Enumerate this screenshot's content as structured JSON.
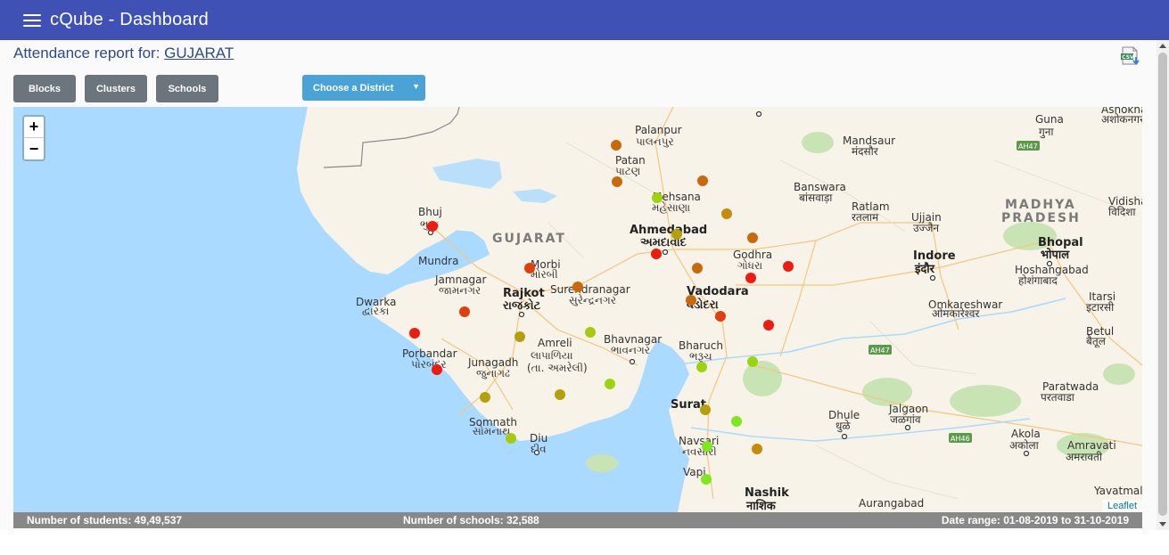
{
  "app": {
    "title": "cQube - Dashboard"
  },
  "report": {
    "prefix": "Attendance report for: ",
    "state": "GUJARAT"
  },
  "buttons": {
    "blocks": "Blocks",
    "clusters": "Clusters",
    "schools": "Schools"
  },
  "district_select": {
    "selected": "Choose a District"
  },
  "map": {
    "zoom_in": "+",
    "zoom_out": "−",
    "attribution": "Leaflet",
    "region_labels": [
      "GUJARAT",
      "MADHYA",
      "PRADESH"
    ],
    "cities": [
      {
        "en": "Bhuj",
        "local": "ભુજ"
      },
      {
        "en": "Mundra",
        "local": ""
      },
      {
        "en": "Jamnagar",
        "local": "જામનગર"
      },
      {
        "en": "Rajkot",
        "local": "રાજકોટ"
      },
      {
        "en": "Morbi",
        "local": "મોરબી"
      },
      {
        "en": "Surendranagar",
        "local": "સુરેન્દ્રનગર"
      },
      {
        "en": "Dwarka",
        "local": "દ્વારકા"
      },
      {
        "en": "Porbandar",
        "local": "પોરબંદર"
      },
      {
        "en": "Junagadh",
        "local": "જુનાગઢ"
      },
      {
        "en": "Amreli",
        "local": "લાપાળિયા"
      },
      {
        "en": "",
        "local": "(તા. અમરેલી)"
      },
      {
        "en": "Bhavnagar",
        "local": "ભાવનગર"
      },
      {
        "en": "Somnath",
        "local": "સોમનાથ"
      },
      {
        "en": "Diu",
        "local": "દીવ"
      },
      {
        "en": "Palanpur",
        "local": "પાલનપુર"
      },
      {
        "en": "Patan",
        "local": "પાટણ"
      },
      {
        "en": "Mehsana",
        "local": "મહેસાણા"
      },
      {
        "en": "Ahmedabad",
        "local": "અમદાવાદ"
      },
      {
        "en": "Godhra",
        "local": "ગોધરા"
      },
      {
        "en": "Vadodara",
        "local": "વડોદરા"
      },
      {
        "en": "Bharuch",
        "local": "ભરૂચ"
      },
      {
        "en": "Surat",
        "local": ""
      },
      {
        "en": "Navsari",
        "local": "નવસારી"
      },
      {
        "en": "Vapi",
        "local": "વાપી"
      },
      {
        "en": "Nashik",
        "local": "नाशिक"
      },
      {
        "en": "Aurangabad",
        "local": ""
      },
      {
        "en": "Dhule",
        "local": "धुळे"
      },
      {
        "en": "Jalgaon",
        "local": "जळगांव"
      },
      {
        "en": "Akola",
        "local": "अकोला"
      },
      {
        "en": "Amravati",
        "local": "अमरावती"
      },
      {
        "en": "Yavatmal",
        "local": ""
      },
      {
        "en": "Paratwada",
        "local": "परतवाडा"
      },
      {
        "en": "Betul",
        "local": "बैतूल"
      },
      {
        "en": "Itarsi",
        "local": "इटारसी"
      },
      {
        "en": "Hoshangabad",
        "local": "होशंगाबाद"
      },
      {
        "en": "Bhopal",
        "local": "भोपाल"
      },
      {
        "en": "Vidisha",
        "local": "विदिशा"
      },
      {
        "en": "Guna",
        "local": "गुना"
      },
      {
        "en": "Ashoknagar",
        "local": "अशोकनगर"
      },
      {
        "en": "Indore",
        "local": "इंदौर"
      },
      {
        "en": "Ujjain",
        "local": "उज्जैन"
      },
      {
        "en": "Omkareshwar",
        "local": "ओमकारेश्वर"
      },
      {
        "en": "Ratlam",
        "local": "रतलाम"
      },
      {
        "en": "Banswara",
        "local": "बांसवाड़ा"
      },
      {
        "en": "Mandsaur",
        "local": "मंदसौर"
      }
    ],
    "highway_labels": [
      "AH47",
      "AH47",
      "AH46"
    ],
    "status_colors": {
      "red": "#ee1b10",
      "red_orange": "#e0400e",
      "orange": "#c96a0a",
      "dark_yellow": "#b3a00a",
      "lime": "#9bd40e",
      "green": "#7ee81a"
    }
  },
  "footer": {
    "students": "Number of students: 49,49,537",
    "schools": "Number of schools: 32,588",
    "date_range": "Date range: 01-08-2019 to 31-10-2019"
  }
}
